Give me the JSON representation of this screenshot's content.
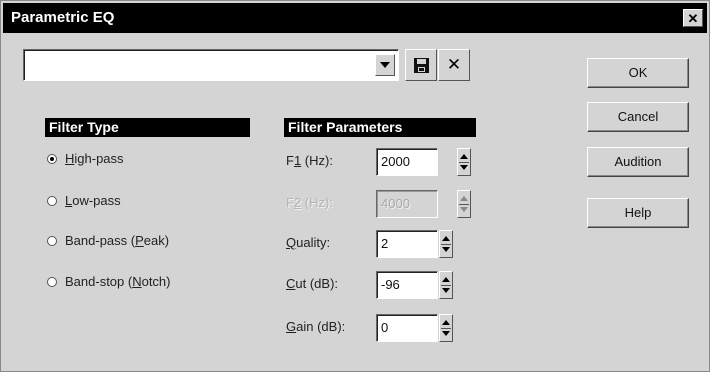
{
  "window": {
    "title": "Parametric EQ",
    "close_glyph": "✕"
  },
  "preset": {
    "value": ""
  },
  "toolbar": {
    "save_icon": "save-disk-icon",
    "delete_glyph": "✕"
  },
  "buttons": {
    "ok": "OK",
    "cancel": "Cancel",
    "audition": "Audition",
    "help": "Help"
  },
  "filter_type": {
    "header": "Filter Type",
    "options": [
      {
        "pre": "",
        "key": "H",
        "post": "igh-pass",
        "checked": true
      },
      {
        "pre": "",
        "key": "L",
        "post": "ow-pass",
        "checked": false
      },
      {
        "pre": "Band-pass (",
        "key": "P",
        "post": "eak)",
        "checked": false
      },
      {
        "pre": "Band-stop (",
        "key": "N",
        "post": "otch)",
        "checked": false
      }
    ]
  },
  "filter_params": {
    "header": "Filter Parameters",
    "f1": {
      "pre": "F",
      "key": "1",
      "post": " (Hz):",
      "value": "2000"
    },
    "f2": {
      "pre": "F",
      "key": "2",
      "post": " (Hz):",
      "value": "4000",
      "disabled": true
    },
    "quality": {
      "pre": "",
      "key": "Q",
      "post": "uality:",
      "value": "2"
    },
    "cut": {
      "pre": "",
      "key": "C",
      "post": "ut (dB):",
      "value": "-96"
    },
    "gain": {
      "pre": "",
      "key": "G",
      "post": "ain (dB):",
      "value": "0"
    }
  }
}
